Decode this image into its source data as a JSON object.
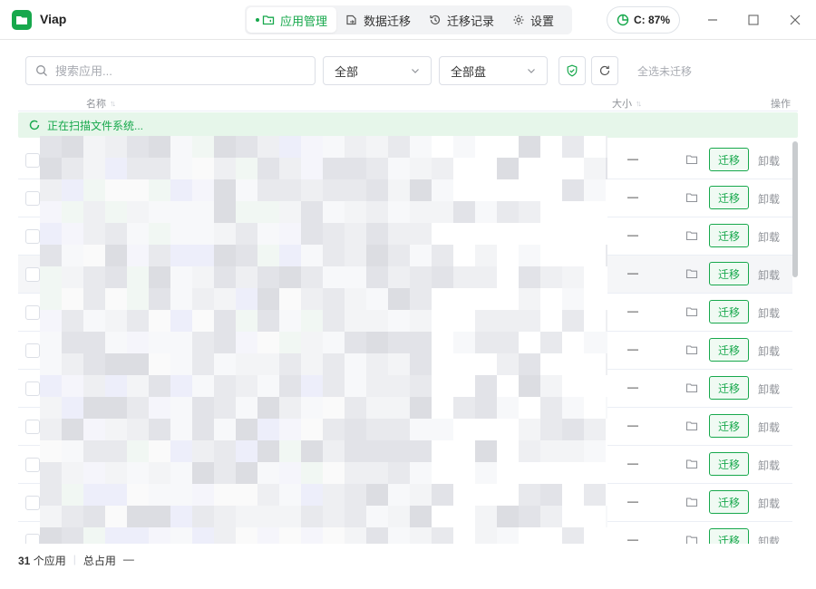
{
  "app": {
    "name": "Viap"
  },
  "nav": {
    "tabs": [
      {
        "label": "应用管理",
        "icon": "app-folder-icon",
        "active": true
      },
      {
        "label": "数据迁移",
        "icon": "data-migrate-icon",
        "active": false
      },
      {
        "label": "迁移记录",
        "icon": "history-icon",
        "active": false
      },
      {
        "label": "设置",
        "icon": "gear-icon",
        "active": false
      }
    ]
  },
  "disk": {
    "label": "C: 87%",
    "percent": 87
  },
  "toolbar": {
    "search_placeholder": "搜索应用...",
    "filter_type": "全部",
    "filter_disk": "全部盘",
    "select_unmigrated": "全选未迁移"
  },
  "table": {
    "col_name": "名称",
    "col_size": "大小",
    "col_action": "操作",
    "scanning_text": "正在扫描文件系统...",
    "rows": [
      {
        "size": "—",
        "migrate": "迁移",
        "uninstall": "卸载"
      },
      {
        "size": "—",
        "migrate": "迁移",
        "uninstall": "卸载"
      },
      {
        "size": "—",
        "migrate": "迁移",
        "uninstall": "卸载"
      },
      {
        "size": "—",
        "migrate": "迁移",
        "uninstall": "卸载"
      },
      {
        "size": "—",
        "migrate": "迁移",
        "uninstall": "卸载"
      },
      {
        "size": "—",
        "migrate": "迁移",
        "uninstall": "卸载"
      },
      {
        "size": "—",
        "migrate": "迁移",
        "uninstall": "卸载"
      },
      {
        "size": "—",
        "migrate": "迁移",
        "uninstall": "卸载"
      },
      {
        "size": "—",
        "migrate": "迁移",
        "uninstall": "卸载"
      },
      {
        "size": "—",
        "migrate": "迁移",
        "uninstall": "卸载"
      },
      {
        "size": "—",
        "migrate": "迁移",
        "uninstall": "卸载"
      }
    ]
  },
  "footer": {
    "count": "31",
    "count_suffix": "个应用",
    "total_label": "总占用",
    "total_value": "—"
  },
  "colors": {
    "accent": "#17a84c",
    "scan_bg": "#e6f6ea"
  }
}
